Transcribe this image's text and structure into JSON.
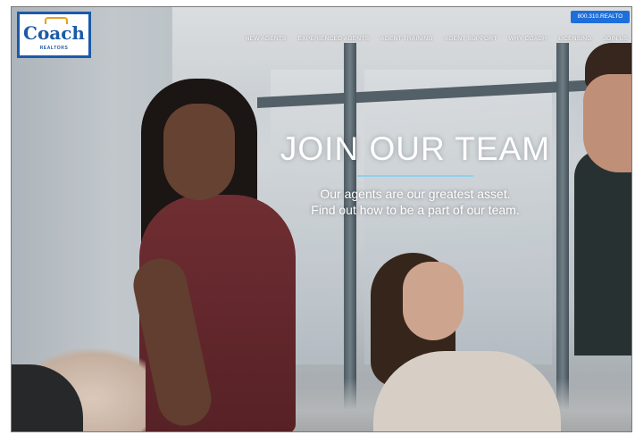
{
  "brand": {
    "logo_word": "Coach",
    "logo_sub": "REALTORS"
  },
  "header": {
    "phone_button": "800.310.REALTO"
  },
  "nav": {
    "items": [
      "NEW AGENTS",
      "EXPERIENCED AGENTS",
      "AGENT TRAINING",
      "AGENT SUPPORT",
      "WHY COACH",
      "LICENSING",
      "JOIN US"
    ]
  },
  "hero": {
    "title": "JOIN OUR TEAM",
    "line1": "Our agents are our greatest asset.",
    "line2": "Find out how to be a part of our team."
  },
  "colors": {
    "brand_blue": "#1b5aa8",
    "button_blue": "#1e6fd9",
    "accent_rule": "#8fd0ec"
  }
}
